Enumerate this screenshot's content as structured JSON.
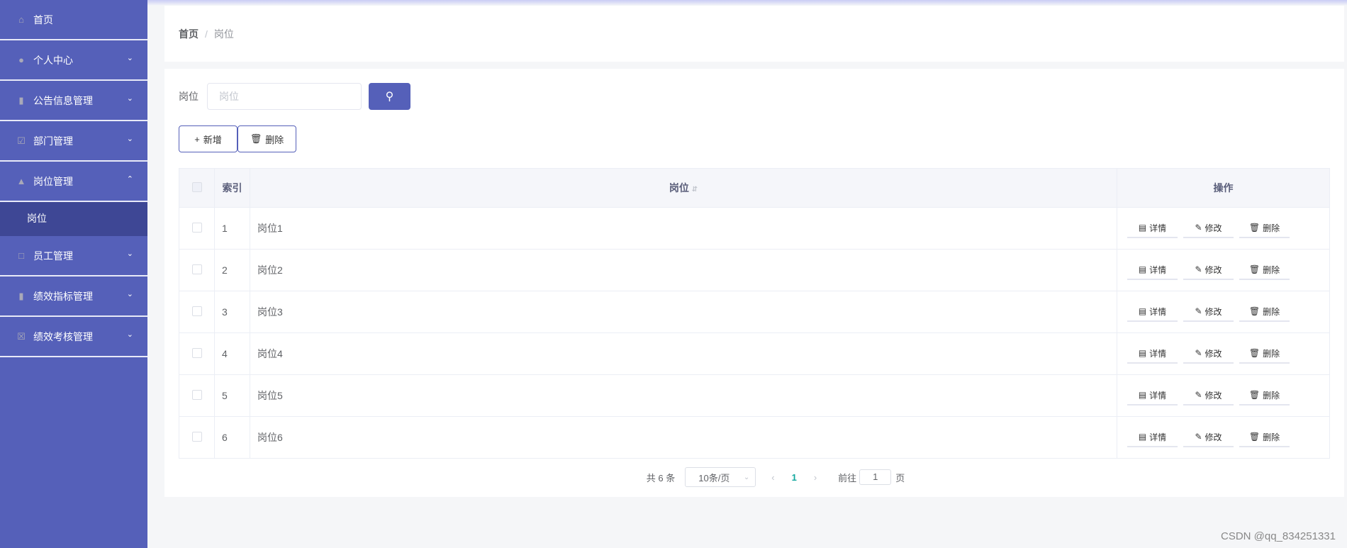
{
  "sidebar": {
    "items": [
      {
        "label": "首页",
        "icon": "home-icon"
      },
      {
        "label": "个人中心",
        "icon": "user-icon"
      },
      {
        "label": "公告信息管理",
        "icon": "microphone-icon"
      },
      {
        "label": "部门管理",
        "icon": "clipboard-icon"
      },
      {
        "label": "岗位管理",
        "icon": "stamp-icon",
        "expanded": true
      },
      {
        "label": "员工管理",
        "icon": "crop-icon"
      },
      {
        "label": "绩效指标管理",
        "icon": "microphone-icon"
      },
      {
        "label": "绩效考核管理",
        "icon": "clipboard-x-icon"
      }
    ],
    "sub_item": "岗位"
  },
  "breadcrumb": {
    "home": "首页",
    "sep": "/",
    "current": "岗位"
  },
  "search": {
    "label": "岗位",
    "placeholder": "岗位"
  },
  "toolbar": {
    "add": "新增",
    "delete": "删除"
  },
  "table": {
    "headers": {
      "index": "索引",
      "position": "岗位",
      "actions": "操作"
    },
    "rows": [
      {
        "index": "1",
        "position": "岗位1"
      },
      {
        "index": "2",
        "position": "岗位2"
      },
      {
        "index": "3",
        "position": "岗位3"
      },
      {
        "index": "4",
        "position": "岗位4"
      },
      {
        "index": "5",
        "position": "岗位5"
      },
      {
        "index": "6",
        "position": "岗位6"
      }
    ],
    "actions": {
      "detail": "详情",
      "edit": "修改",
      "delete": "删除"
    }
  },
  "pagination": {
    "total": "共 6 条",
    "page_size": "10条/页",
    "current": "1",
    "goto_label": "前往",
    "goto_value": "1",
    "page_suffix": "页"
  },
  "watermark": "CSDN @qq_834251331"
}
